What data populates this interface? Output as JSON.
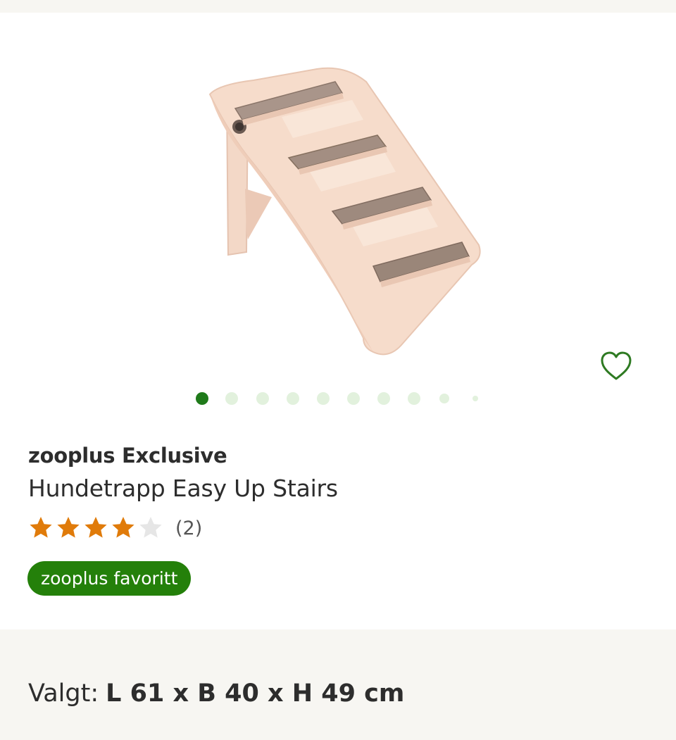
{
  "product": {
    "brand": "zooplus Exclusive",
    "name": "Hundetrapp Easy Up Stairs",
    "image_icon": "pet-stairs-image",
    "rating": {
      "value": 4,
      "max": 5,
      "count_label": "(2)"
    },
    "badge_label": "zooplus favoritt",
    "wishlist_icon": "heart-outline-icon"
  },
  "carousel": {
    "total_indicators": 10,
    "active_index": 0
  },
  "selection": {
    "label": "Valgt:",
    "value": "L 61 x B 40 x H 49 cm"
  },
  "colors": {
    "accent_green": "#24800a",
    "star_orange": "#e07b0a",
    "star_empty": "#e6e6e6",
    "dot_inactive": "#e2f1dd",
    "dot_active": "#1f7a1a"
  }
}
